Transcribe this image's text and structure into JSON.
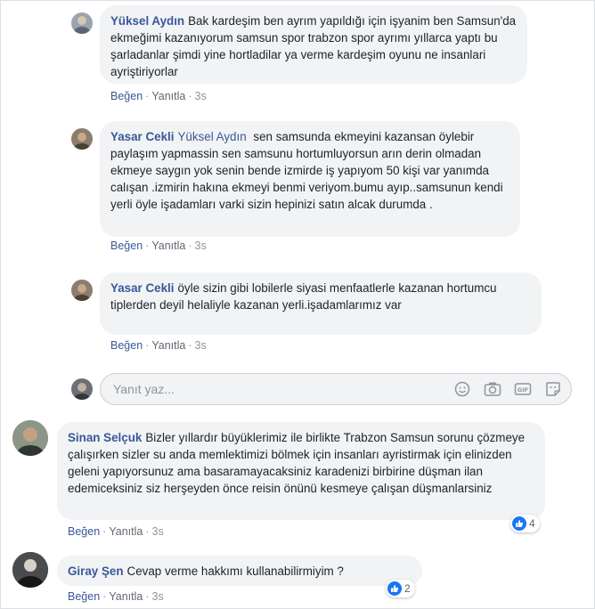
{
  "comments": [
    {
      "author": "Yüksel Aydın",
      "text": "Bak kardeşim ben ayrım yapıldığı için işyanim ben Samsun'da ekmeğimi kazanıyorum samsun spor trabzon spor ayrımı yıllarca yaptı bu şarladanlar şimdi yine hortladilar ya verme kardeşim oyunu ne insanlari ayriştiriyorlar",
      "like": "Beğen",
      "reply": "Yanıtla",
      "time": "3s"
    },
    {
      "author": "Yasar Cekli",
      "mention": "Yüksel Aydın",
      "text": "sen samsunda ekmeyini kazansan öylebir paylaşım yapmassin sen samsunu hortumluyorsun arın derin olmadan ekmeye saygın yok senin bende izmirde iş yapıyom 50 kişi var yanımda calışan .izmirin hakına ekmeyi benmi veriyom.bumu ayıp..samsunun kendi yerli öyle işadamları varki sizin hepinizi satın alcak durumda .",
      "like": "Beğen",
      "reply": "Yanıtla",
      "time": "3s"
    },
    {
      "author": "Yasar Cekli",
      "text": "öyle sizin gibi lobilerle siyasi menfaatlerle kazanan hortumcu tiplerden deyil helaliyle kazanan yerli.işadamlarımız var",
      "like": "Beğen",
      "reply": "Yanıtla",
      "time": "3s"
    },
    {
      "author": "Sinan Selçuk",
      "text": "Bizler yıllardır büyüklerimiz ile birlikte Trabzon Samsun sorunu çözmeye çalışırken sizler su anda memlektimizi bölmek için insanları ayristirmak için elinizden geleni yapıyorsunuz ama basaramayacaksiniz karadenizi birbirine düşman ilan edemiceksiniz siz herşeyden önce reisin önünü kesmeye çalışan düşmanlarsiniz",
      "like": "Beğen",
      "reply": "Yanıtla",
      "time": "3s",
      "reactions": "4"
    },
    {
      "author": "Giray Şen",
      "text": "Cevap verme hakkımı kullanabilirmiyim ?",
      "like": "Beğen",
      "reply": "Yanıtla",
      "time": "3s",
      "reactions": "2"
    }
  ],
  "reply_box": {
    "placeholder": "Yanıt yaz...",
    "tools": [
      "emoji-icon",
      "camera-icon",
      "gif-icon",
      "sticker-icon"
    ]
  },
  "colors": {
    "author": "#385898",
    "bubble": "#f2f3f5",
    "like": "#1877f2"
  }
}
